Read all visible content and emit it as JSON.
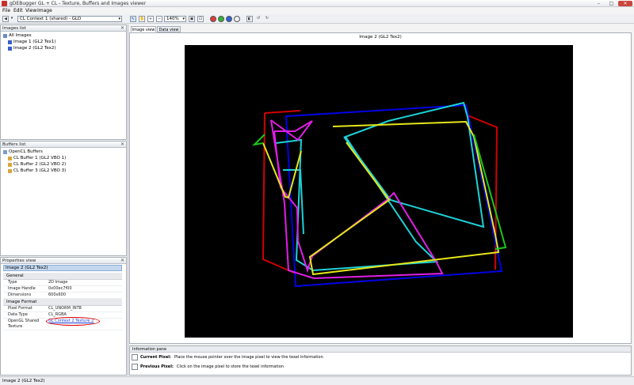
{
  "window": {
    "title": "gDEBugger GL + CL - Texture, Buffers and Images viewer",
    "controls": {
      "minimize": "–",
      "maximize": "□",
      "close": "✕"
    }
  },
  "menu": [
    "File",
    "Edit",
    "View",
    "Image"
  ],
  "toolbar": {
    "context_select": "CL Context 1 (shared) - GLD",
    "zoom_select": "140%"
  },
  "images_list": {
    "title": "Images list",
    "root": "All Images",
    "items": [
      "Image 1 (GL2 Tex1)",
      "Image 2 (GL2 Tex2)"
    ]
  },
  "buffers_list": {
    "title": "Buffers list",
    "root": "OpenCL Buffers",
    "items": [
      "CL Buffer 1 (GL2 VBO 1)",
      "CL Buffer 2 (GL2 VBO 2)",
      "CL Buffer 3 (GL2 VBO 3)"
    ]
  },
  "properties": {
    "title": "Properties view",
    "selected": "Image 2 (GL2 Tex2)",
    "sections": [
      {
        "name": "General",
        "rows": [
          {
            "k": "Type",
            "v": "2D Image"
          },
          {
            "k": "Image Handle",
            "v": "0x00ec7f00"
          },
          {
            "k": "Dimensions",
            "v": "600x600"
          }
        ]
      },
      {
        "name": "Image Format",
        "rows": [
          {
            "k": "Pixel Format",
            "v": "CL_UNORM_INT8"
          },
          {
            "k": "Data Type",
            "v": "CL_RGBA"
          },
          {
            "k": "OpenGL Shared Texture",
            "v": "GL Context 2 Texture 2",
            "link": true
          }
        ]
      }
    ],
    "highlight_color": "#e00000"
  },
  "tabs": [
    "Image view",
    "Data view"
  ],
  "viewer": {
    "caption": "Image 2 (GL2 Tex2)"
  },
  "info_pane": {
    "title": "Information pane",
    "current_label": "Current Pixel:",
    "current_text": "Place the mouse pointer over the image pixel to view the texel information",
    "previous_label": "Previous Pixel:",
    "previous_text": "Click on the image pixel to store the texel information"
  },
  "status": "Image 2 (GL2 Tex2)",
  "colors": {
    "red": "#d20000",
    "blue": "#0000e6",
    "cyan": "#1ed2d7",
    "magenta": "#e01ee6",
    "yellow": "#e6e619",
    "green": "#19c819",
    "canvas": "#000000",
    "selection": "#c3d7ef"
  }
}
